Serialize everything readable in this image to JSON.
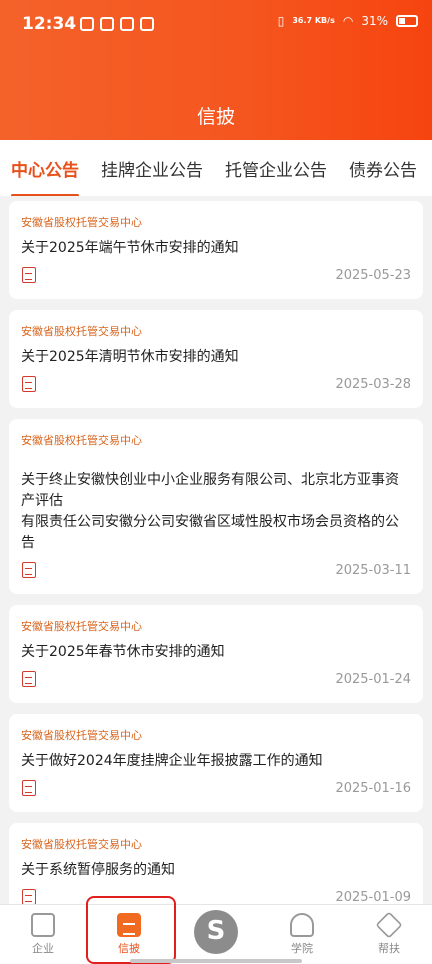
{
  "status_bar": {
    "time": "12:34",
    "net_speed": "36.7 KB/s",
    "battery": "31%"
  },
  "header": {
    "title": "信披"
  },
  "tabs": [
    {
      "label": "中心公告",
      "active": true
    },
    {
      "label": "挂牌企业公告",
      "active": false
    },
    {
      "label": "托管企业公告",
      "active": false
    },
    {
      "label": "债券公告",
      "active": false
    }
  ],
  "announcements": [
    {
      "source": "安徽省股权托管交易中心",
      "title": "关于2025年端午节休市安排的通知",
      "date": "2025-05-23"
    },
    {
      "source": "安徽省股权托管交易中心",
      "title": "关于2025年清明节休市安排的通知",
      "date": "2025-03-28"
    },
    {
      "source": "安徽省股权托管交易中心",
      "title": "关于终止安徽快创业中小企业服务有限公司、北京北方亚事资产评估\n有限责任公司安徽分公司安徽省区域性股权市场会员资格的公告",
      "date": "2025-03-11"
    },
    {
      "source": "安徽省股权托管交易中心",
      "title": "关于2025年春节休市安排的通知",
      "date": "2025-01-24"
    },
    {
      "source": "安徽省股权托管交易中心",
      "title": "关于做好2024年度挂牌企业年报披露工作的通知",
      "date": "2025-01-16"
    },
    {
      "source": "安徽省股权托管交易中心",
      "title": "关于系统暂停服务的通知",
      "date": "2025-01-09"
    }
  ],
  "bottom_nav": {
    "items": [
      {
        "label": "企业",
        "icon": "building-icon"
      },
      {
        "label": "信披",
        "icon": "document-icon",
        "active": true
      },
      {
        "label": "",
        "icon": "center-logo-icon"
      },
      {
        "label": "学院",
        "icon": "graduation-cap-icon"
      },
      {
        "label": "帮扶",
        "icon": "handshake-icon"
      }
    ]
  },
  "colors": {
    "accent": "#e8501a",
    "header_gradient": [
      "#f4622a",
      "#f6440f"
    ],
    "source_text": "#d9641d"
  }
}
